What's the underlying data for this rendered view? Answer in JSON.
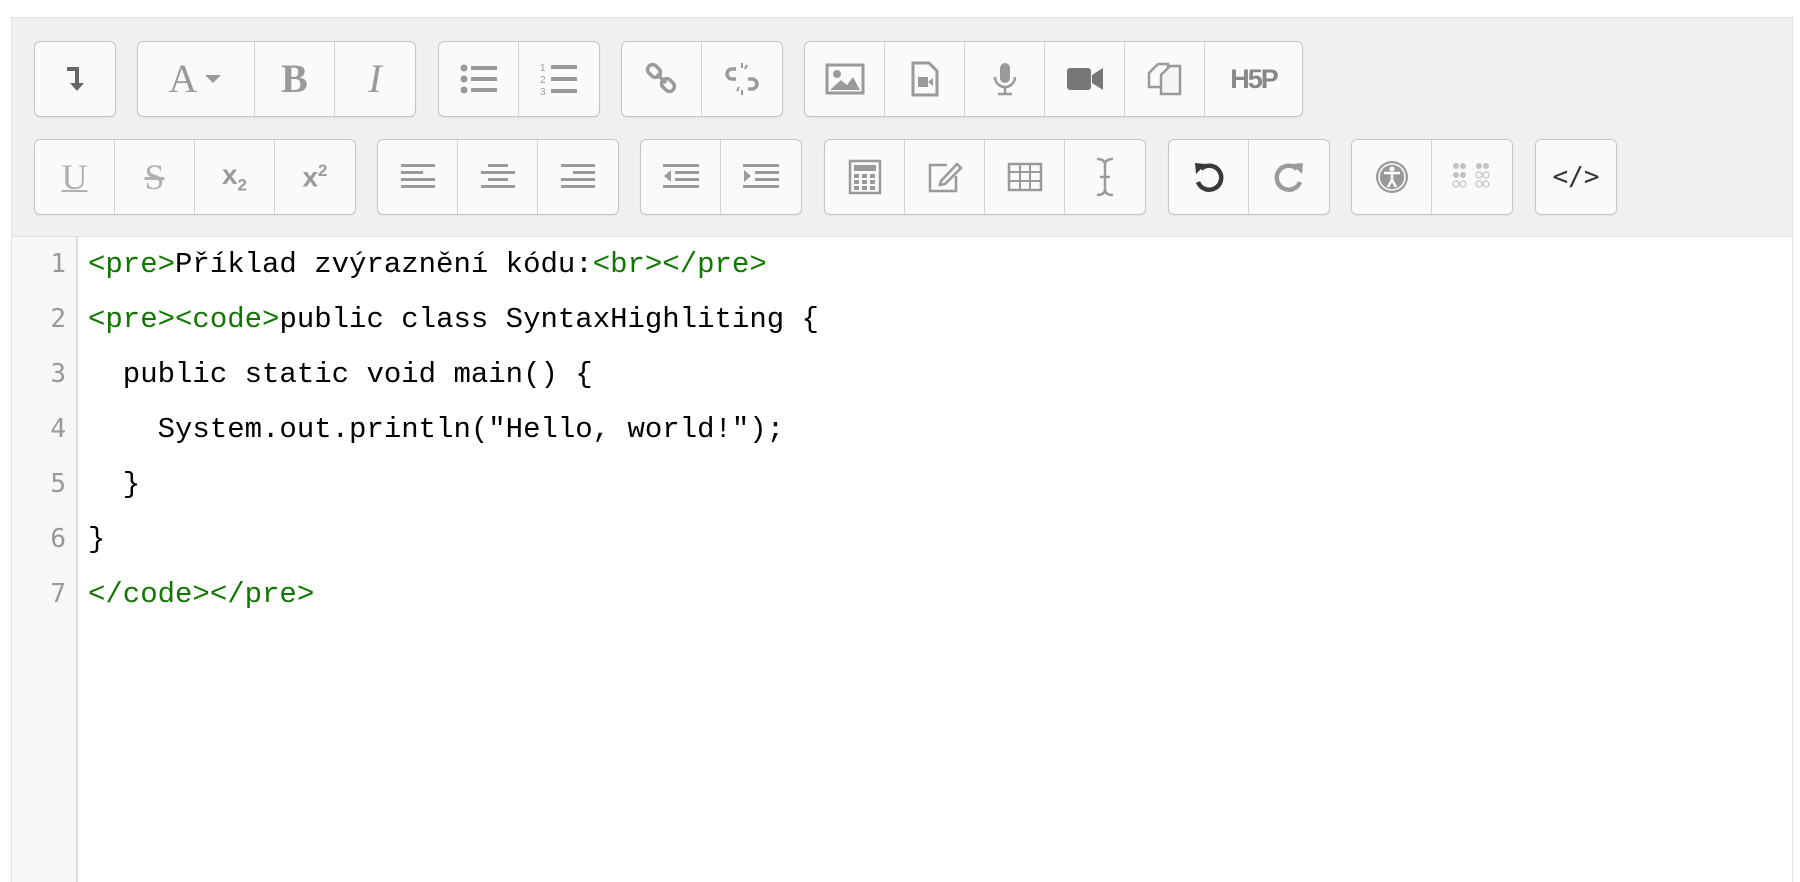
{
  "toolbar": {
    "row1": [
      {
        "group": "expand",
        "buttons": [
          {
            "name": "toolbar-toggle",
            "icon": "arrow-down-right-icon"
          }
        ]
      },
      {
        "group": "text",
        "buttons": [
          {
            "name": "font-style",
            "icon": "font-dropdown-icon",
            "glyph": "A"
          },
          {
            "name": "bold",
            "icon": "bold-icon",
            "glyph": "B"
          },
          {
            "name": "italic",
            "icon": "italic-icon",
            "glyph": "I"
          }
        ]
      },
      {
        "group": "lists",
        "buttons": [
          {
            "name": "unordered-list",
            "icon": "bullet-list-icon"
          },
          {
            "name": "ordered-list",
            "icon": "numbered-list-icon"
          }
        ]
      },
      {
        "group": "links",
        "buttons": [
          {
            "name": "link",
            "icon": "link-icon"
          },
          {
            "name": "unlink",
            "icon": "unlink-icon"
          }
        ]
      },
      {
        "group": "media",
        "buttons": [
          {
            "name": "insert-image",
            "icon": "image-icon"
          },
          {
            "name": "insert-media",
            "icon": "media-file-icon"
          },
          {
            "name": "record-audio",
            "icon": "microphone-icon"
          },
          {
            "name": "record-video",
            "icon": "video-camera-icon"
          },
          {
            "name": "manage-files",
            "icon": "files-icon"
          },
          {
            "name": "insert-h5p",
            "icon": "h5p-icon",
            "glyph": "H5P"
          }
        ]
      }
    ],
    "row2": [
      {
        "group": "style2",
        "buttons": [
          {
            "name": "underline",
            "icon": "underline-icon",
            "glyph": "U"
          },
          {
            "name": "strikethrough",
            "icon": "strikethrough-icon",
            "glyph": "S"
          },
          {
            "name": "subscript",
            "icon": "subscript-icon",
            "glyph": "x",
            "script": "2"
          },
          {
            "name": "superscript",
            "icon": "superscript-icon",
            "glyph": "x",
            "script": "2"
          }
        ]
      },
      {
        "group": "align",
        "buttons": [
          {
            "name": "align-left",
            "icon": "align-left-icon"
          },
          {
            "name": "align-center",
            "icon": "align-center-icon"
          },
          {
            "name": "align-right",
            "icon": "align-right-icon"
          }
        ]
      },
      {
        "group": "indent",
        "buttons": [
          {
            "name": "outdent",
            "icon": "outdent-icon"
          },
          {
            "name": "indent",
            "icon": "indent-icon"
          }
        ]
      },
      {
        "group": "insert",
        "buttons": [
          {
            "name": "equation",
            "icon": "calculator-icon"
          },
          {
            "name": "special-character",
            "icon": "pencil-square-icon"
          },
          {
            "name": "table",
            "icon": "table-icon"
          },
          {
            "name": "clear-formatting",
            "icon": "i-beam-icon"
          }
        ]
      },
      {
        "group": "undo",
        "buttons": [
          {
            "name": "undo",
            "icon": "undo-icon"
          },
          {
            "name": "redo",
            "icon": "redo-icon"
          }
        ]
      },
      {
        "group": "accessibility",
        "buttons": [
          {
            "name": "accessibility-checker",
            "icon": "accessibility-icon"
          },
          {
            "name": "screenreader-helper",
            "icon": "braille-icon"
          }
        ]
      },
      {
        "group": "other",
        "buttons": [
          {
            "name": "html-source",
            "icon": "html-code-icon",
            "glyph": "</>"
          }
        ]
      }
    ]
  },
  "code": {
    "line_numbers": [
      "1",
      "2",
      "3",
      "4",
      "5",
      "6",
      "7"
    ],
    "lines": [
      {
        "tag1": "<pre>",
        "text1": "Příklad zvýraznění kódu:",
        "tag2": "<br></pre>",
        "text2": ""
      },
      {
        "tag1": "<pre><code>",
        "text1": "public class SyntaxHighliting {",
        "tag2": "",
        "text2": ""
      },
      {
        "tag1": "",
        "text1": "  public static void main() {",
        "tag2": "",
        "text2": ""
      },
      {
        "tag1": "",
        "text1": "    System.out.println(\"Hello, world!\");",
        "tag2": "",
        "text2": ""
      },
      {
        "tag1": "",
        "text1": "  }",
        "tag2": "",
        "text2": ""
      },
      {
        "tag1": "",
        "text1": "}",
        "tag2": "",
        "text2": ""
      },
      {
        "tag1": "</code></pre>",
        "text1": "",
        "tag2": "",
        "text2": ""
      }
    ]
  },
  "colors": {
    "tag": "#117700",
    "text": "#000000",
    "toolbar_bg": "#f0f0f0",
    "gutter_bg": "#f7f7f7"
  }
}
